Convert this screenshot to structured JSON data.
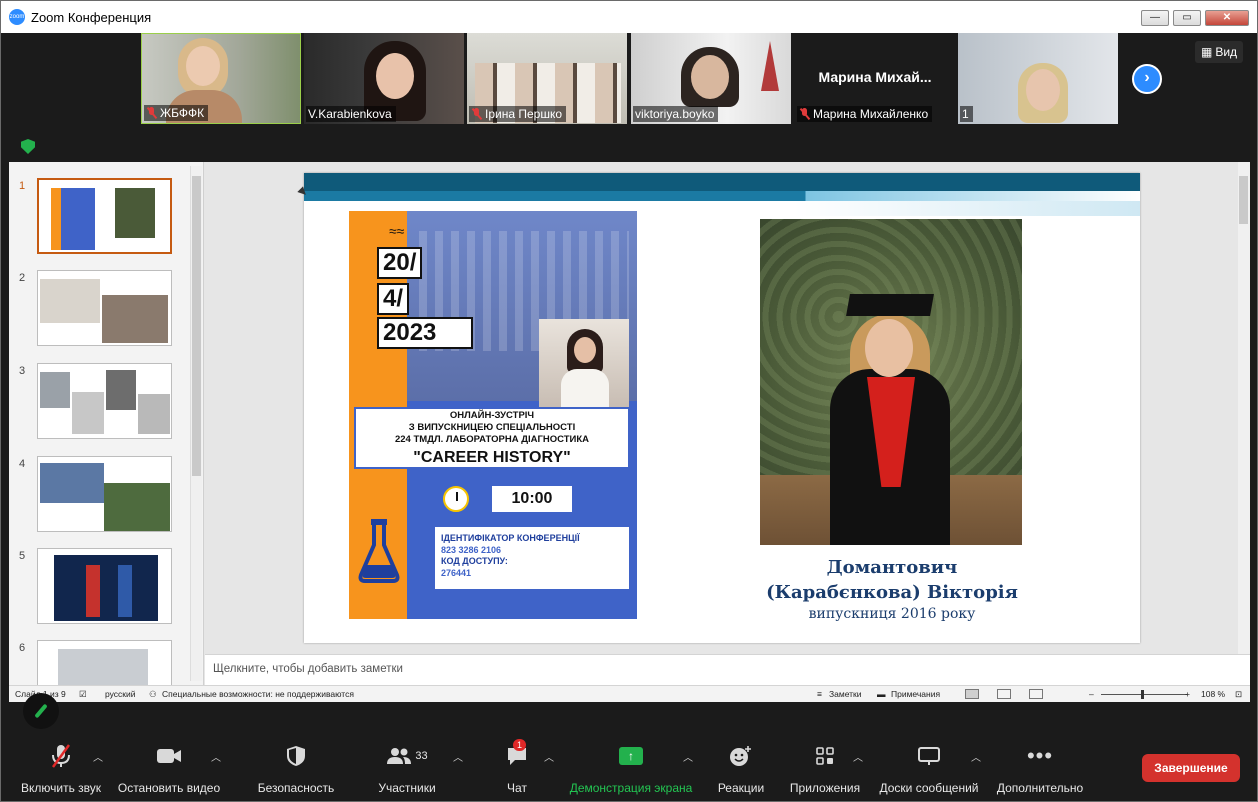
{
  "window": {
    "title": "Zoom Конференция",
    "logo_text": "zoom"
  },
  "window_controls": {
    "minimize": "—",
    "maximize": "▭",
    "close": "✕"
  },
  "participants_strip": {
    "view_label": "Вид",
    "next_label": "›",
    "tiles": [
      {
        "name": "ЖБФФК",
        "muted": true
      },
      {
        "name": "V.Karabienkova",
        "muted": false
      },
      {
        "name": "Ірина Першко",
        "muted": true
      },
      {
        "name": "viktoriya.boyko",
        "muted": false
      },
      {
        "name": "Марина Михайленко",
        "muted": true,
        "display_name": "Марина  Михай..."
      },
      {
        "name": "1",
        "muted": false
      }
    ]
  },
  "powerpoint": {
    "thumbnails": [
      "1",
      "2",
      "3",
      "4",
      "5",
      "6"
    ],
    "active_slide": 1,
    "notes_placeholder": "Щелкните, чтобы добавить заметки",
    "status": {
      "slide_info": "Слайд 1 из 9",
      "language": "русский",
      "accessibility": "Специальные возможности: не поддерживаются",
      "notes": "Заметки",
      "comments": "Примечания",
      "zoom_minus": "–",
      "zoom_plus": "+",
      "zoom": "108 %"
    }
  },
  "slide": {
    "poster": {
      "date_line1": "20/",
      "date_line2": "4/",
      "date_line3": "2023",
      "info_line1": "ОНЛАЙН-ЗУСТРІЧ",
      "info_line2": "З ВИПУСКНИЦЕЮ СПЕЦІАЛЬНОСТІ",
      "info_line3": "224 ТМДЛ. ЛАБОРАТОРНА ДІАГНОСТИКА",
      "title": "\"CAREER HISTORY\"",
      "time": "10:00",
      "conf_id_label": "ІДЕНТИФІКАТОР КОНФЕРЕНЦІЇ",
      "conf_id": "823 3286 2106",
      "access_label": "КОД ДОСТУПУ:",
      "access_code": "276441"
    },
    "graduate_name_line1": "Домантович",
    "graduate_name_line2": "(Карабєнкова) Вікторія",
    "graduate_subtitle": "випускниця 2016 року"
  },
  "toolbar": {
    "audio": "Включить звук",
    "video": "Остановить видео",
    "security": "Безопасность",
    "participants": "Участники",
    "participants_count": "33",
    "chat": "Чат",
    "chat_badge": "1",
    "share": "Демонстрация экрана",
    "reactions": "Реакции",
    "apps": "Приложения",
    "whiteboards": "Доски сообщений",
    "more": "Дополнительно",
    "end": "Завершение"
  },
  "colors": {
    "zoom_blue": "#2d8cff",
    "share_green": "#23b14d",
    "end_red": "#d4322d",
    "slide_band": "#0f5a7a",
    "poster_orange": "#f7941d",
    "poster_blue": "#3f63c8"
  }
}
